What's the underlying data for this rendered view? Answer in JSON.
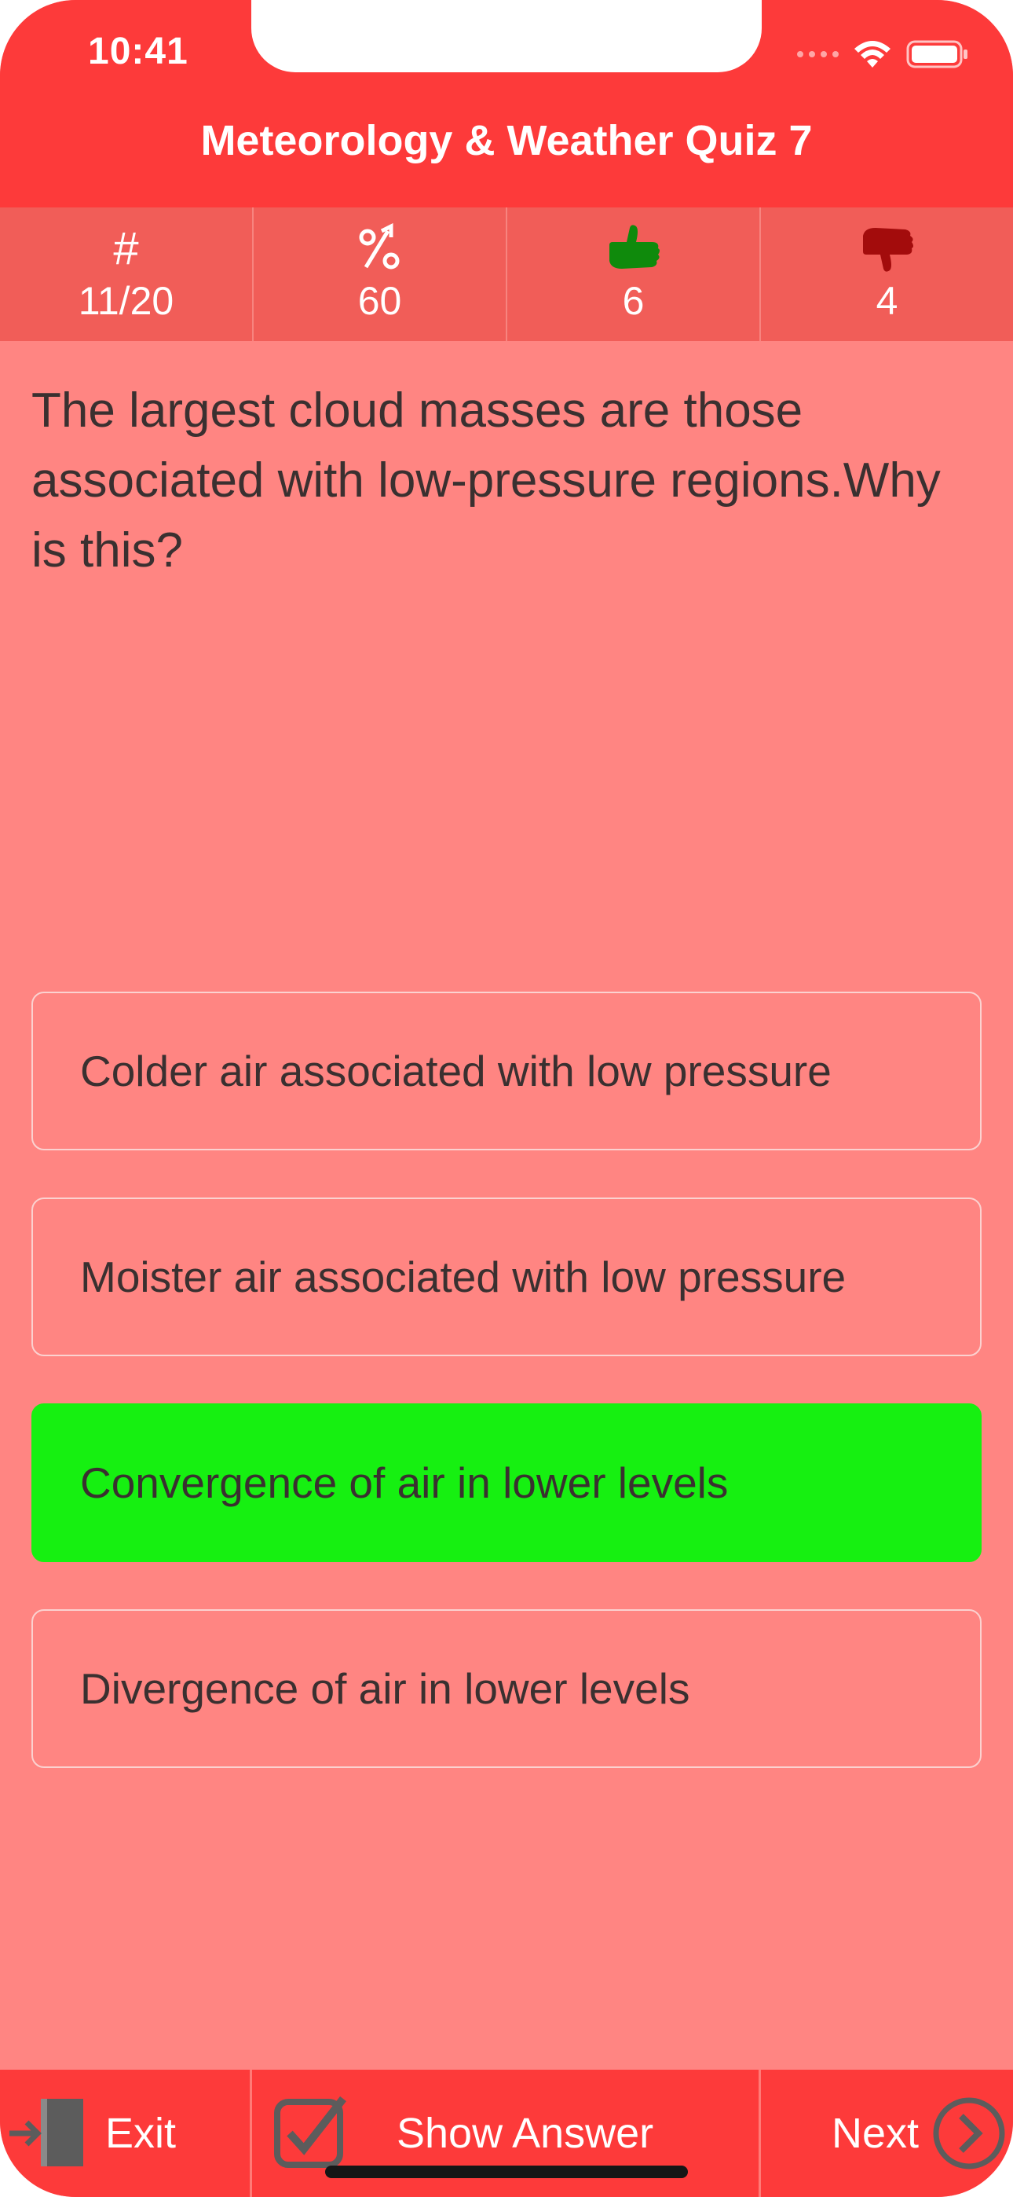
{
  "status_bar": {
    "time": "10:41"
  },
  "header": {
    "title": "Meteorology & Weather Quiz 7"
  },
  "stats": [
    {
      "icon": "hash-icon",
      "glyph": "#",
      "value": "11/20"
    },
    {
      "icon": "percent-up-icon",
      "glyph": "%",
      "value": "60"
    },
    {
      "icon": "thumbs-up-icon",
      "value": "6",
      "color": "#0f8a0c"
    },
    {
      "icon": "thumbs-down-icon",
      "value": "4",
      "color": "#a30c0c"
    }
  ],
  "question": "The largest cloud masses are those associated with low-pressure regions.Why is this?",
  "answers": [
    {
      "label": "Colder air associated with low pressure",
      "state": "default"
    },
    {
      "label": "Moister air associated with low pressure",
      "state": "default"
    },
    {
      "label": "Convergence of air in lower levels",
      "state": "correct"
    },
    {
      "label": "Divergence of air in lower levels",
      "state": "default"
    }
  ],
  "footer": {
    "exit_label": "Exit",
    "show_answer_label": "Show Answer",
    "next_label": "Next"
  },
  "colors": {
    "header": "#fd3a3a",
    "stats_bar": "#f15d58",
    "background": "#ff8582",
    "correct": "#16f011"
  }
}
